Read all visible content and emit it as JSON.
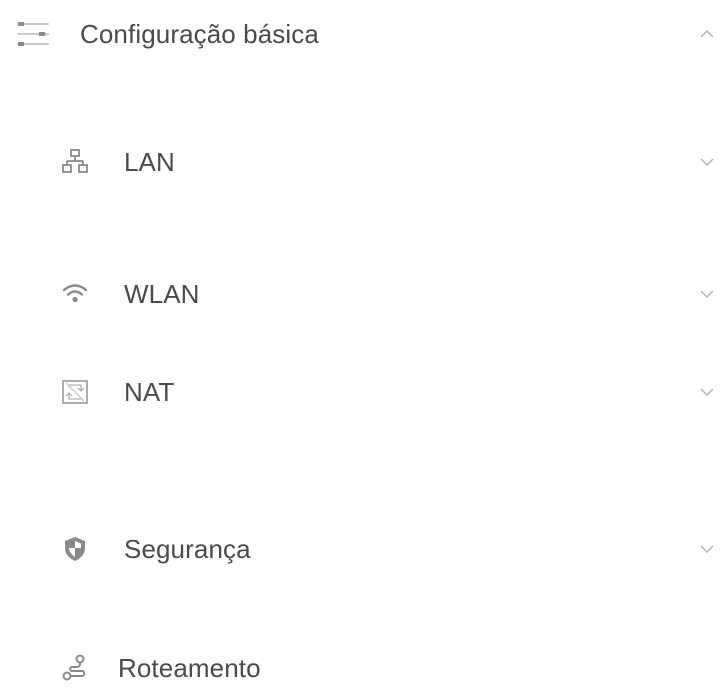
{
  "menu": {
    "header": {
      "label": "Configuração básica",
      "icon": "settings-list-icon",
      "expanded": true
    },
    "items": [
      {
        "label": "LAN",
        "icon": "network-topology-icon",
        "has_chevron": true
      },
      {
        "label": "WLAN",
        "icon": "wifi-icon",
        "has_chevron": true
      },
      {
        "label": "NAT",
        "icon": "nat-icon",
        "has_chevron": true
      },
      {
        "label": "Segurança",
        "icon": "shield-icon",
        "has_chevron": true
      },
      {
        "label": "Roteamento",
        "icon": "route-icon",
        "has_chevron": false
      }
    ]
  },
  "colors": {
    "text": "#4b4b4b",
    "icon": "#8a8a8a",
    "chevron": "#b5b5b5",
    "background": "#ffffff"
  }
}
